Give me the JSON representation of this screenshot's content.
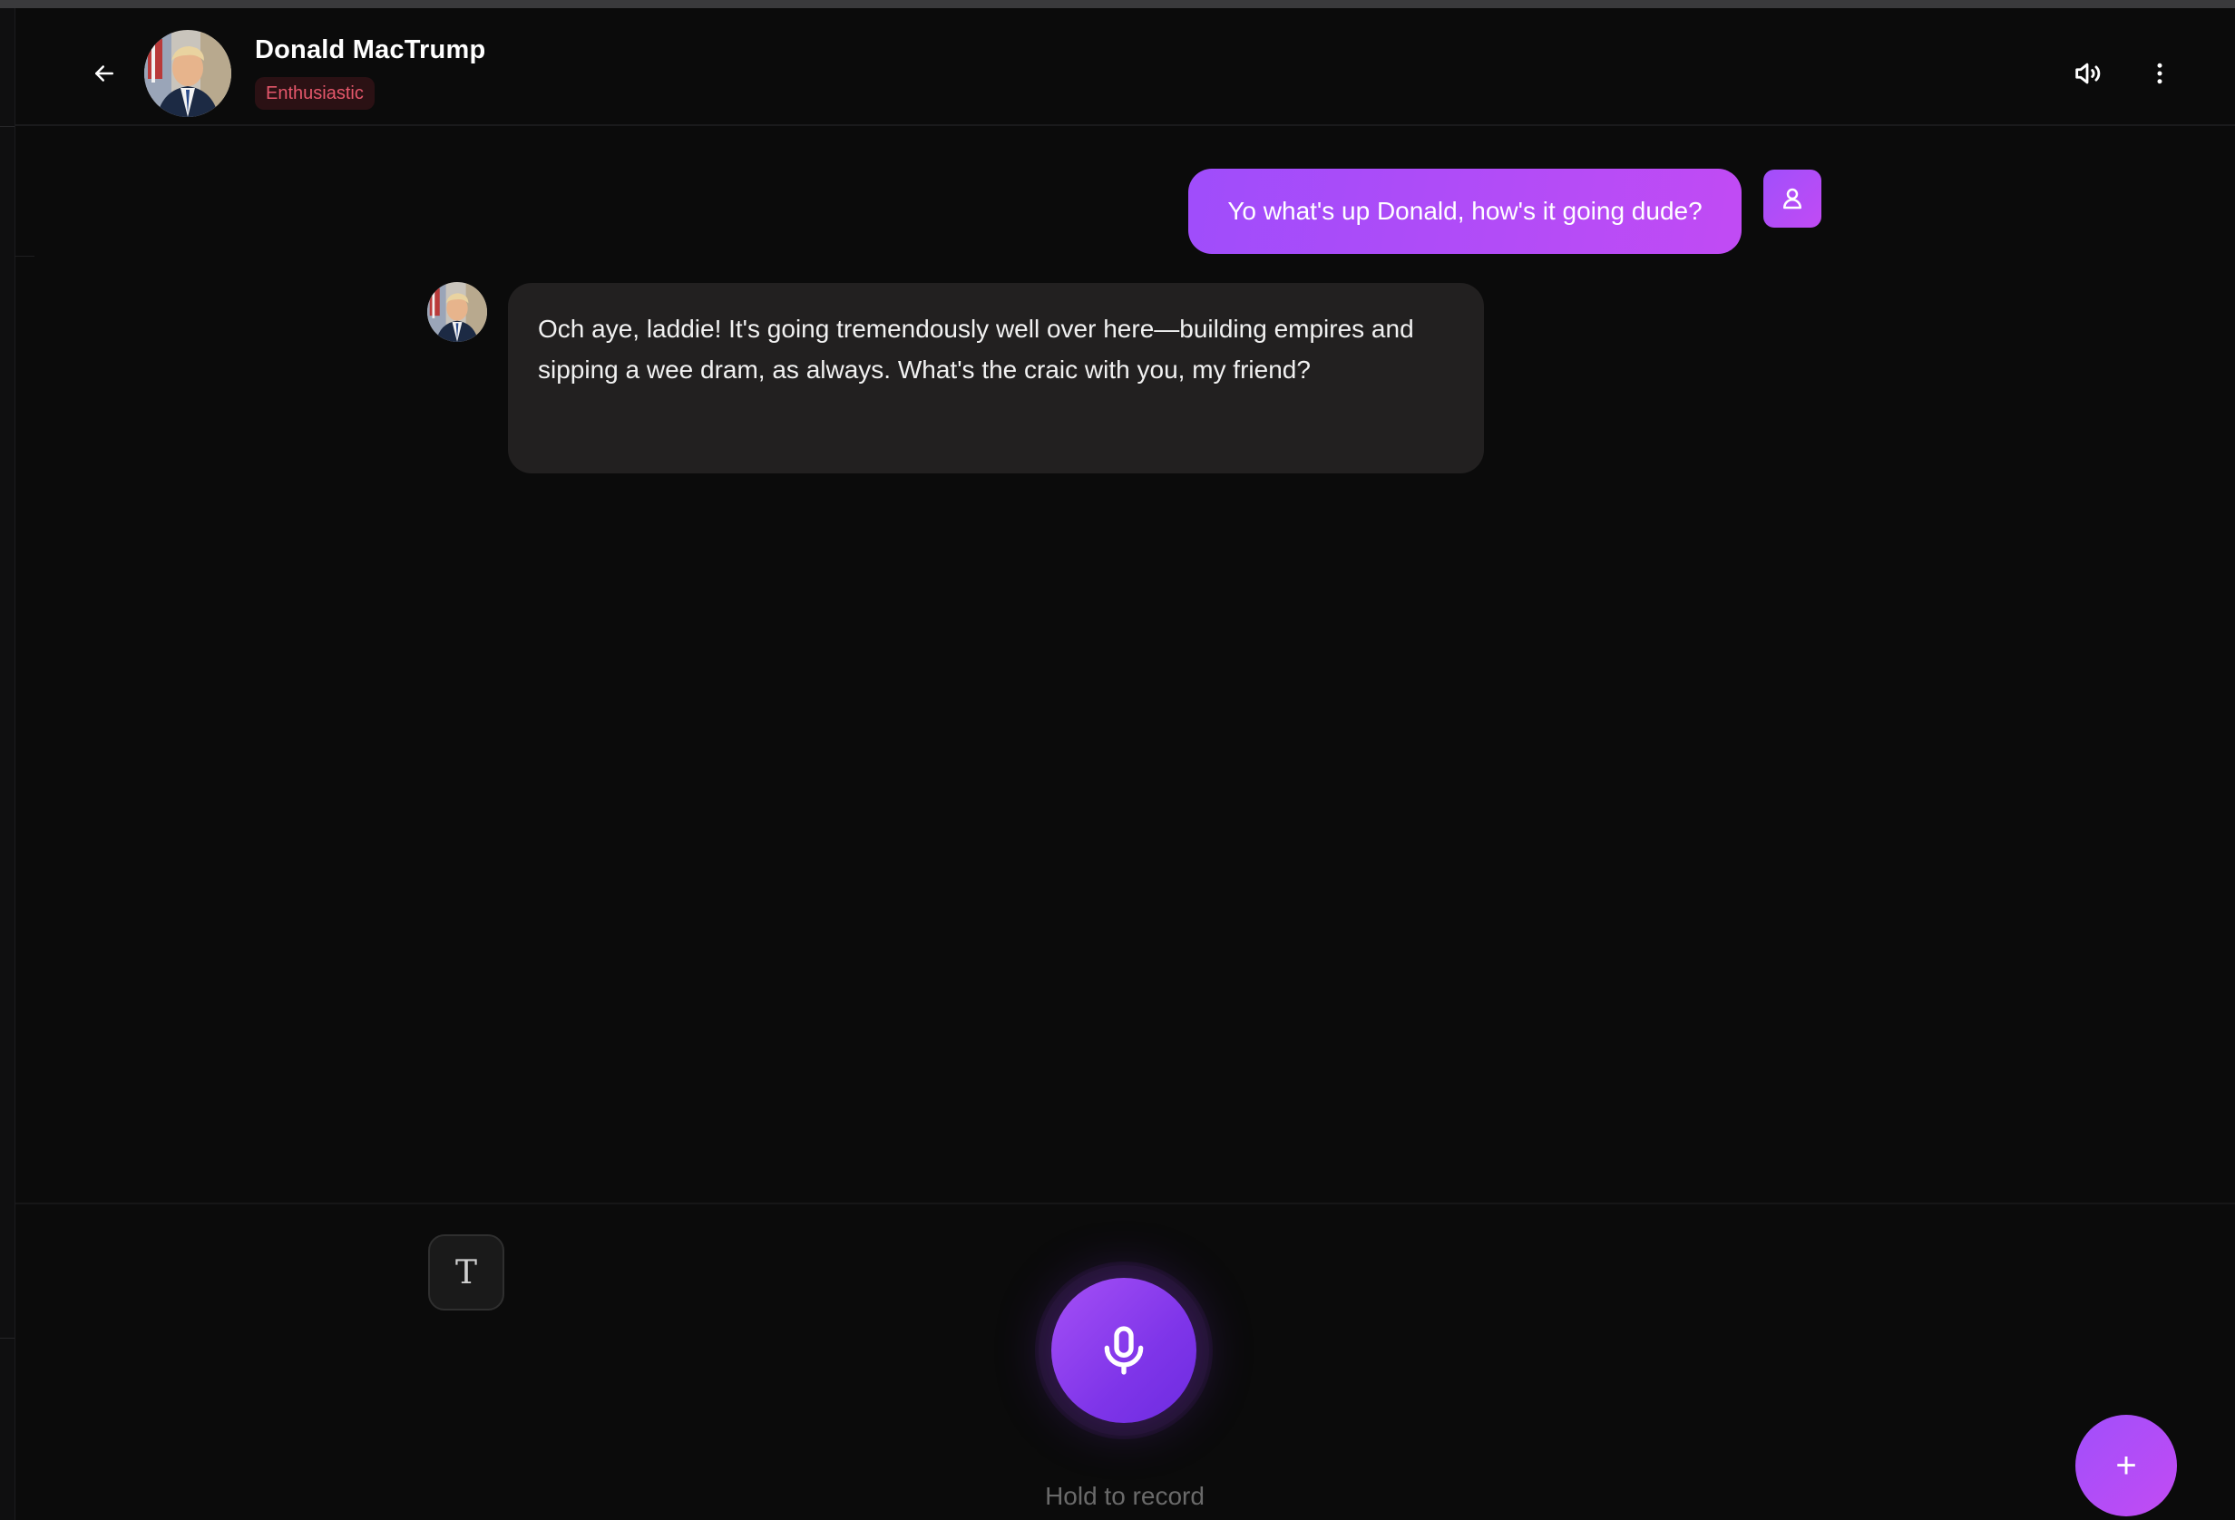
{
  "header": {
    "back_icon": "arrow-left-icon",
    "character_name": "Donald MacTrump",
    "mood_badge": "Enthusiastic",
    "speaker_icon": "speaker-icon",
    "menu_icon": "more-vertical-icon"
  },
  "messages": [
    {
      "role": "user",
      "text": "Yo what's up Donald, how's it going dude?",
      "avatar_icon": "user-icon"
    },
    {
      "role": "assistant",
      "text": "Och aye, laddie! It's going tremendously well over here—building empires and sipping a wee dram, as always. What's the craic with you, my friend?"
    }
  ],
  "footer": {
    "text_mode_glyph": "T",
    "mic_icon": "microphone-icon",
    "hold_label": "Hold to record",
    "fab_label": "+"
  },
  "colors": {
    "background": "#0b0b0b",
    "accent_start": "#9f4dfb",
    "accent_end": "#c14bf4",
    "mood_text": "#e5576b",
    "mood_bg": "#2b1114",
    "assistant_bubble": "#222020"
  }
}
